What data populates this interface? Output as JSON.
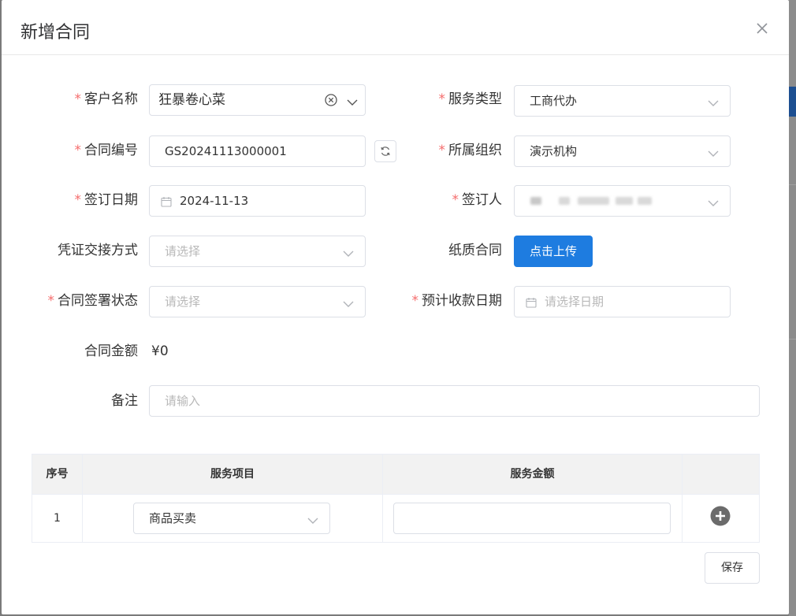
{
  "dialog": {
    "title": "新增合同"
  },
  "form": {
    "customer": {
      "label": "客户名称",
      "value": "狂暴卷心菜",
      "required": "*"
    },
    "service_type": {
      "label": "服务类型",
      "value": "工商代办",
      "required": "*"
    },
    "contract_no": {
      "label": "合同编号",
      "value": "GS20241113000001",
      "required": "*"
    },
    "org": {
      "label": "所属组织",
      "value": "演示机构",
      "required": "*"
    },
    "sign_date": {
      "label": "签订日期",
      "value": "2024-11-13",
      "required": "*"
    },
    "signer": {
      "label": "签订人",
      "required": "*"
    },
    "voucher_method": {
      "label": "凭证交接方式",
      "placeholder": "请选择"
    },
    "paper_contract": {
      "label": "纸质合同",
      "button": "点击上传"
    },
    "sign_status": {
      "label": "合同签署状态",
      "placeholder": "请选择",
      "required": "*"
    },
    "expected_date": {
      "label": "预计收款日期",
      "placeholder": "请选择日期",
      "required": "*"
    },
    "amount": {
      "label": "合同金额",
      "value": "¥0"
    },
    "remark": {
      "label": "备注",
      "placeholder": "请输入"
    }
  },
  "table": {
    "headers": {
      "index": "序号",
      "item": "服务项目",
      "amount": "服务金额"
    },
    "rows": [
      {
        "index": "1",
        "item": "商品买卖",
        "amount": ""
      }
    ]
  },
  "footer": {
    "save": "保存"
  },
  "colors": {
    "primary": "#1e7ce0",
    "required": "#f56c6c",
    "header_bg": "#f2f2f2"
  }
}
